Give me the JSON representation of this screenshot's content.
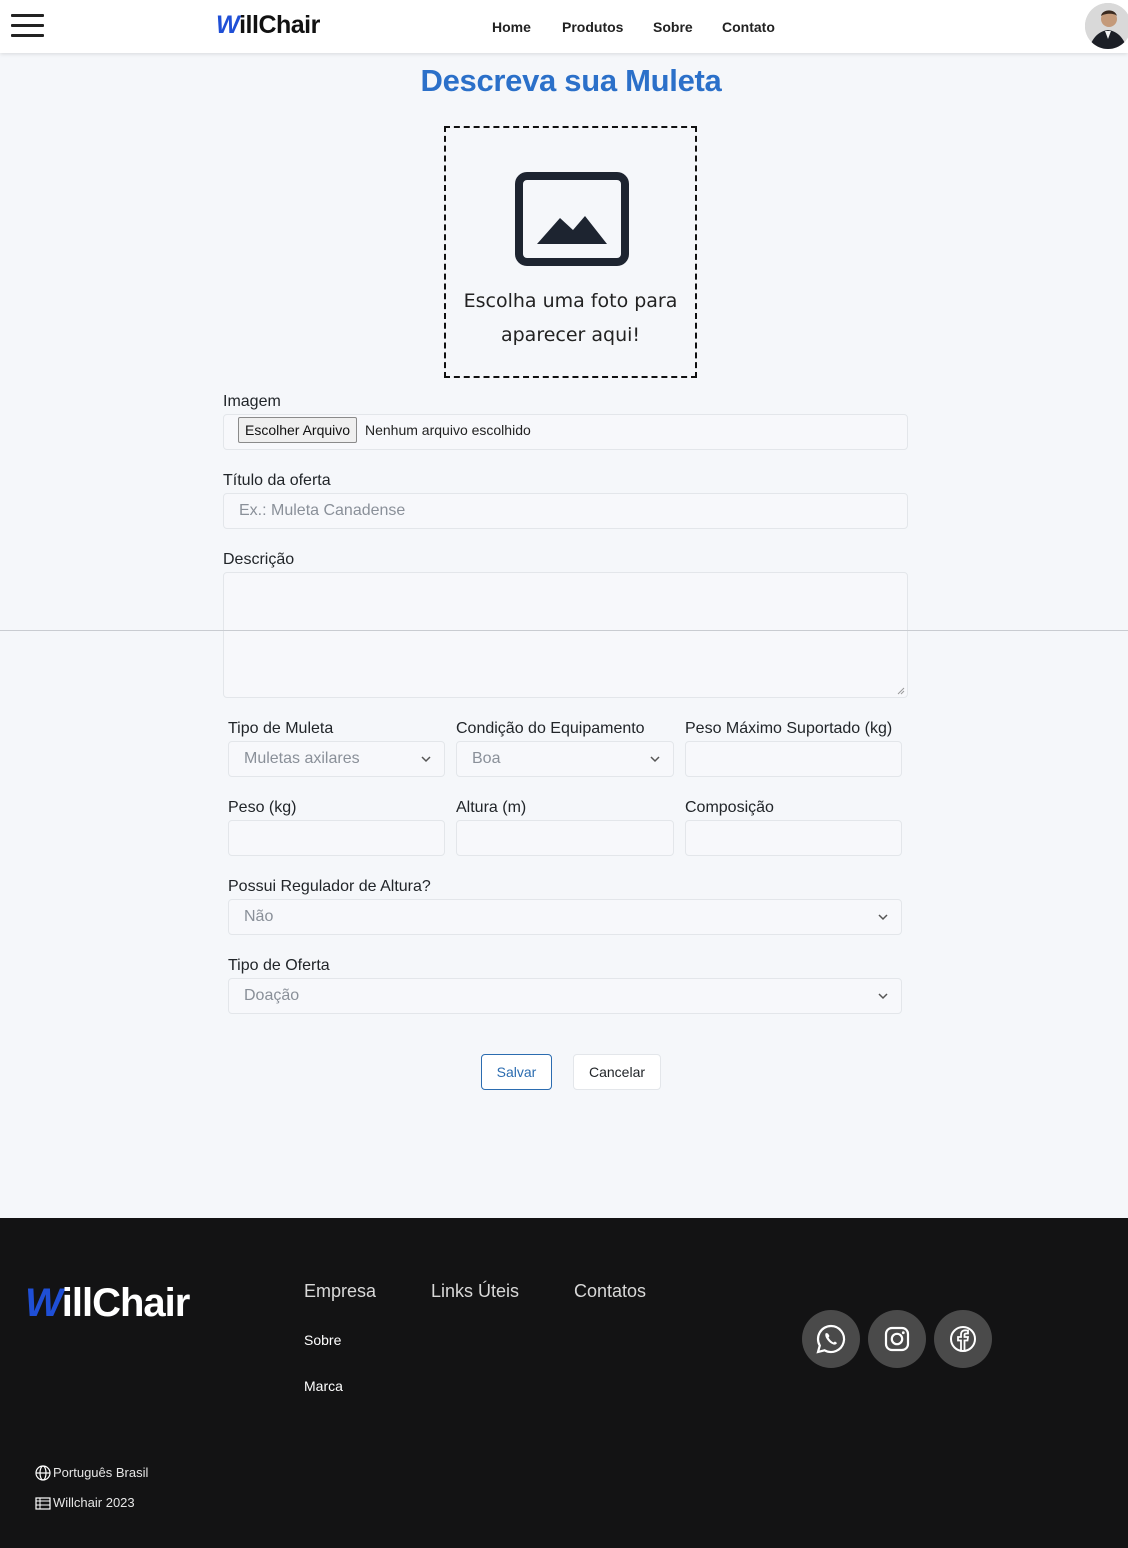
{
  "header": {
    "logo_w": "W",
    "logo_rest": "illChair",
    "nav": [
      "Home",
      "Produtos",
      "Sobre",
      "Contato"
    ]
  },
  "page_title": "Descreva sua Muleta",
  "image_placeholder": {
    "line1": "Escolha uma foto para",
    "line2": "aparecer aqui!"
  },
  "form": {
    "imagem_label": "Imagem",
    "file_button": "Escolher Arquivo",
    "file_status": "Nenhum arquivo escolhido",
    "titulo_label": "Título da oferta",
    "titulo_placeholder": "Ex.: Muleta Canadense",
    "descricao_label": "Descrição",
    "tipo_muleta_label": "Tipo de Muleta",
    "tipo_muleta_value": "Muletas axilares",
    "condicao_label": "Condição do Equipamento",
    "condicao_value": "Boa",
    "peso_max_label": "Peso Máximo Suportado (kg)",
    "peso_label": "Peso (kg)",
    "altura_label": "Altura (m)",
    "composicao_label": "Composição",
    "regulador_label": "Possui Regulador de Altura?",
    "regulador_value": "Não",
    "tipo_oferta_label": "Tipo de Oferta",
    "tipo_oferta_value": "Doação",
    "save_label": "Salvar",
    "cancel_label": "Cancelar"
  },
  "footer": {
    "logo_w": "W",
    "logo_rest": "illChair",
    "columns": [
      "Empresa",
      "Links Úteis",
      "Contatos"
    ],
    "empresa_links": [
      "Sobre",
      "Marca"
    ],
    "social_icons": [
      "whatsapp-icon",
      "instagram-icon",
      "facebook-icon"
    ],
    "language": "Português Brasil",
    "copyright": "Willchair 2023"
  },
  "colors": {
    "brand_blue": "#1f4fd6",
    "title_blue": "#2b70c9",
    "footer_bg": "#131314"
  }
}
